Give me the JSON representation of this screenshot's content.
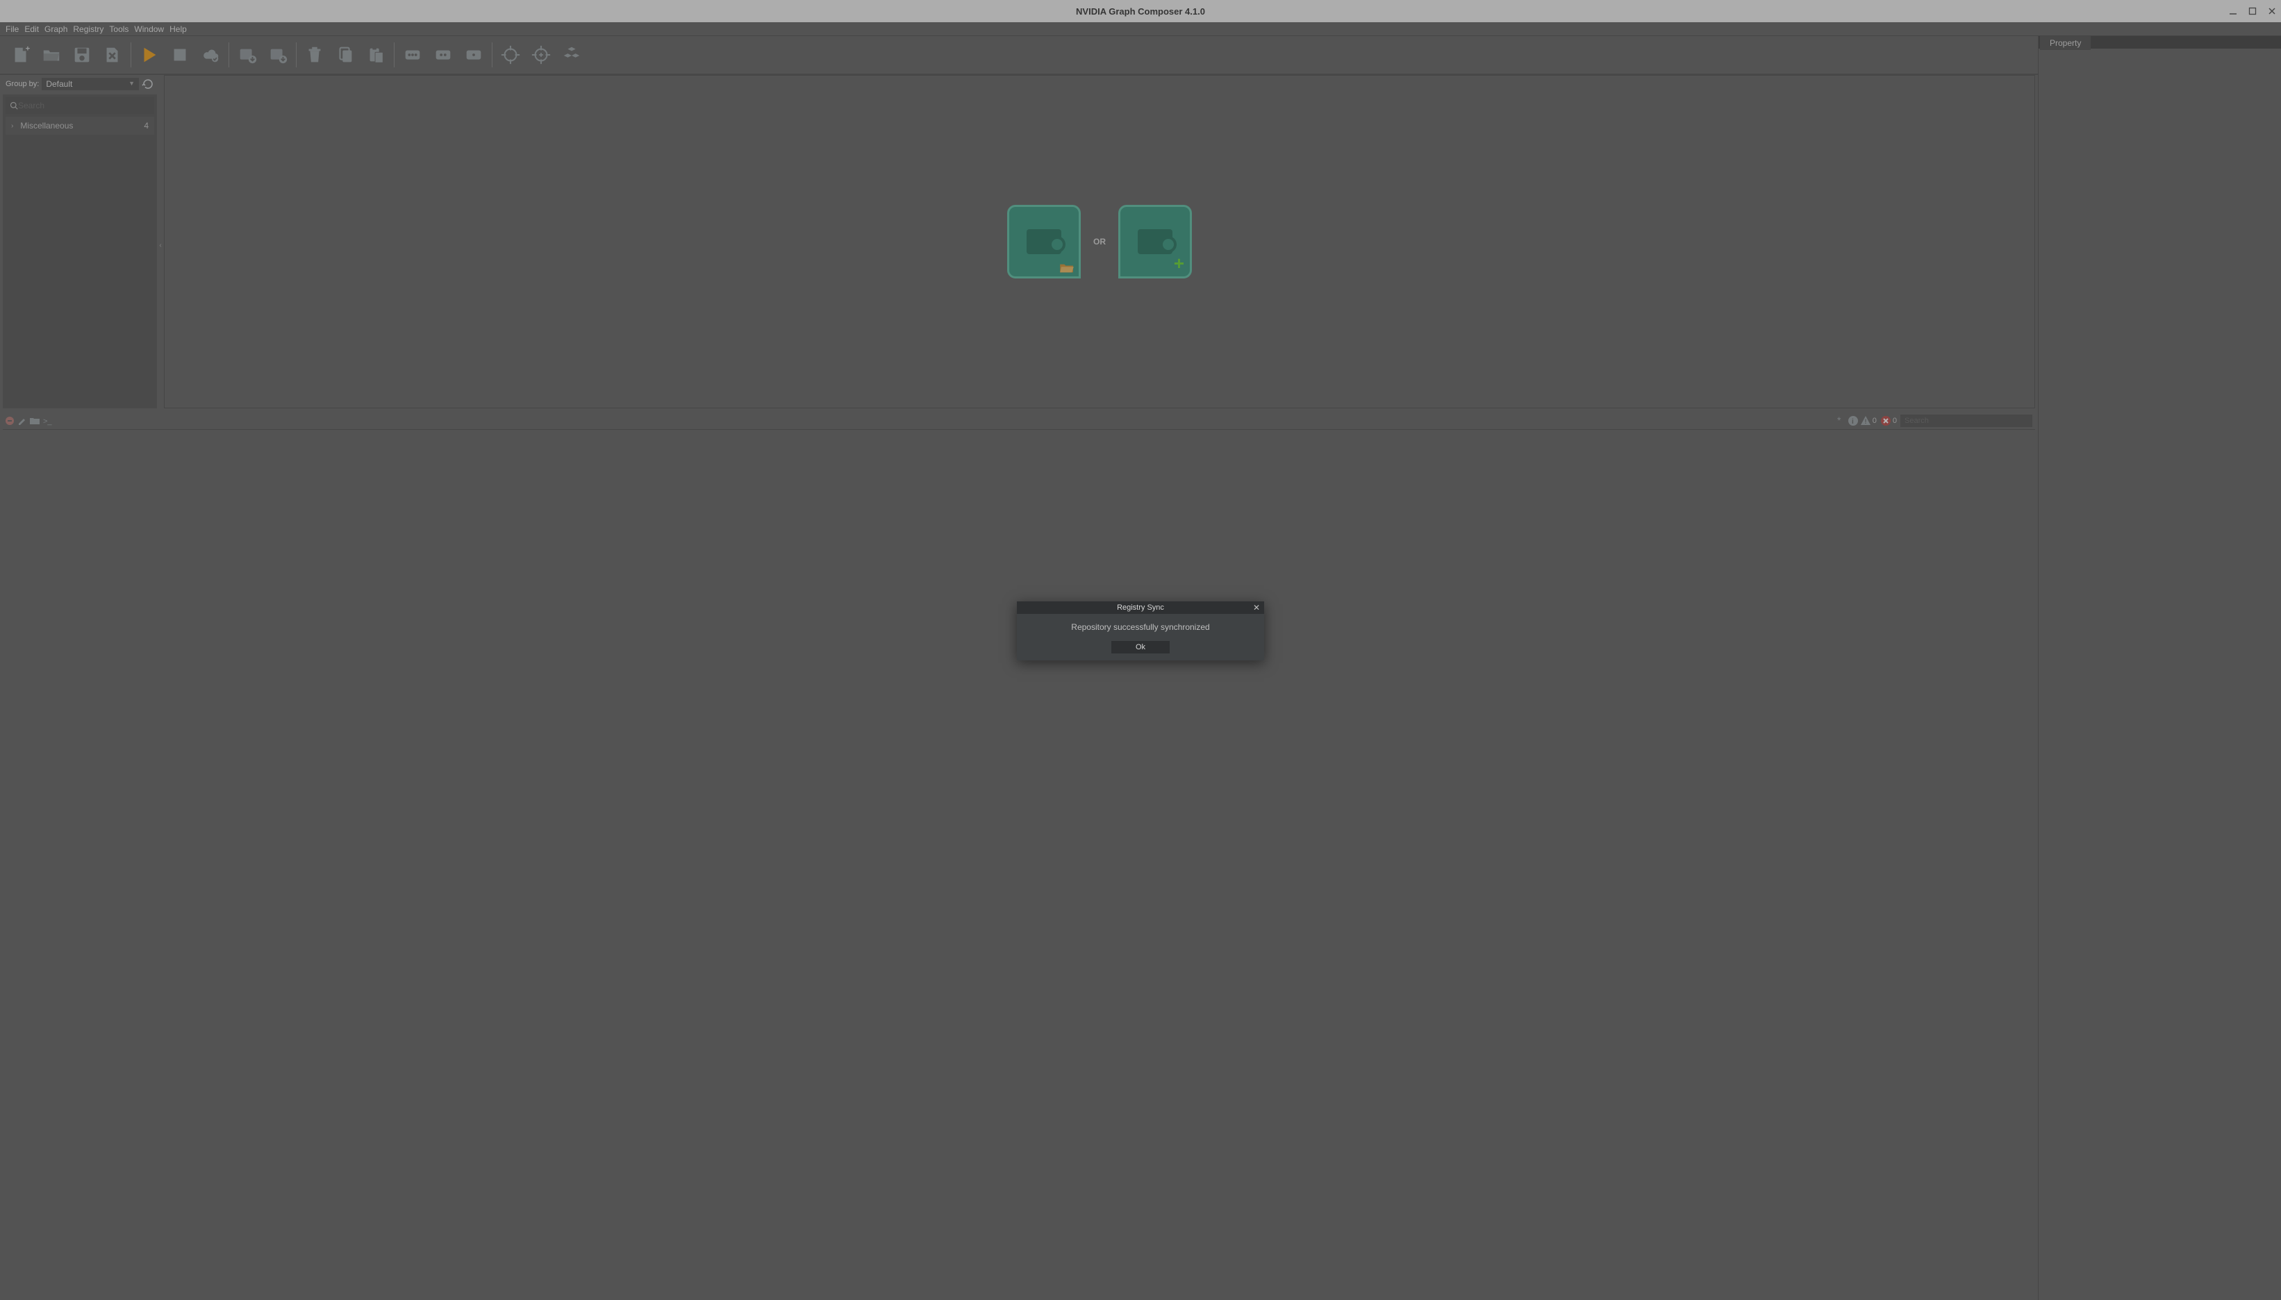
{
  "window": {
    "title": "NVIDIA Graph Composer 4.1.0"
  },
  "menu": {
    "items": [
      "File",
      "Edit",
      "Graph",
      "Registry",
      "Tools",
      "Window",
      "Help"
    ]
  },
  "toolbar_icons": [
    "new-file-icon",
    "open-folder-icon",
    "save-icon",
    "close-file-icon",
    "play-icon",
    "stop-icon",
    "cloud-check-icon",
    "import-down-icon",
    "export-down-icon",
    "trash-icon",
    "copy-icon",
    "paste-icon",
    "more-3dots-icon",
    "more-2dots-icon",
    "more-1dot-icon",
    "target-icon",
    "target-plus-icon",
    "cubes-icon"
  ],
  "left": {
    "groupby_label": "Group by:",
    "groupby_value": "Default",
    "search_placeholder": "Search",
    "tree": [
      {
        "label": "Miscellaneous",
        "count": "4"
      }
    ]
  },
  "canvas": {
    "or_label": "OR",
    "open_hint": "Open existing graph",
    "new_hint": "Create new graph"
  },
  "right": {
    "tab_label": "Property"
  },
  "console": {
    "search_placeholder": "Search",
    "warn_count": "0",
    "error_count": "0"
  },
  "modal": {
    "title": "Registry Sync",
    "message": "Repository successfully synchronized",
    "ok_label": "Ok"
  }
}
